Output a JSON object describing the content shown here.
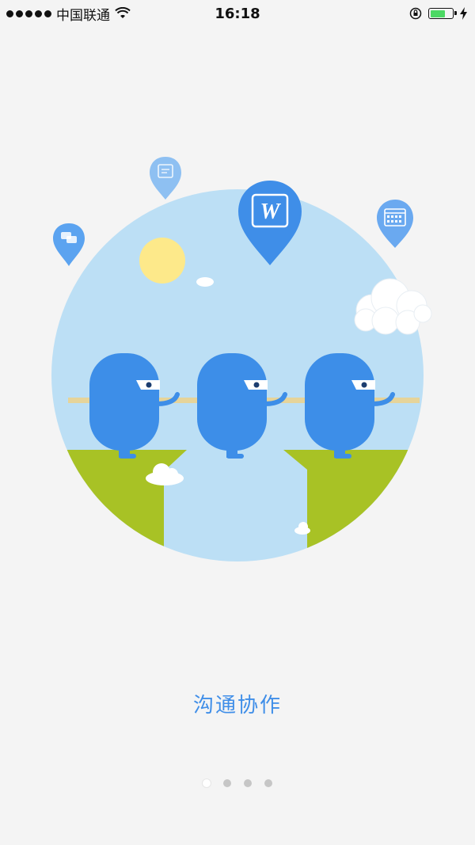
{
  "status_bar": {
    "carrier": "中国联通",
    "time": "16:18"
  },
  "slide": {
    "caption": "沟通协作"
  },
  "pager": {
    "count": 4,
    "active_index": 0
  },
  "colors": {
    "accent": "#3f8ee8",
    "sky": "#bcdff5",
    "grass": "#a8c225",
    "figure": "#3d8ee8",
    "sun": "#fde98a",
    "battery": "#4cd964"
  },
  "icons": [
    "signal-icon",
    "wifi-icon",
    "orientation-lock-icon",
    "battery-icon",
    "charging-icon",
    "chat-pin-icon",
    "note-pin-icon",
    "word-pin-icon",
    "calendar-pin-icon"
  ],
  "pin_word_letter": "W"
}
